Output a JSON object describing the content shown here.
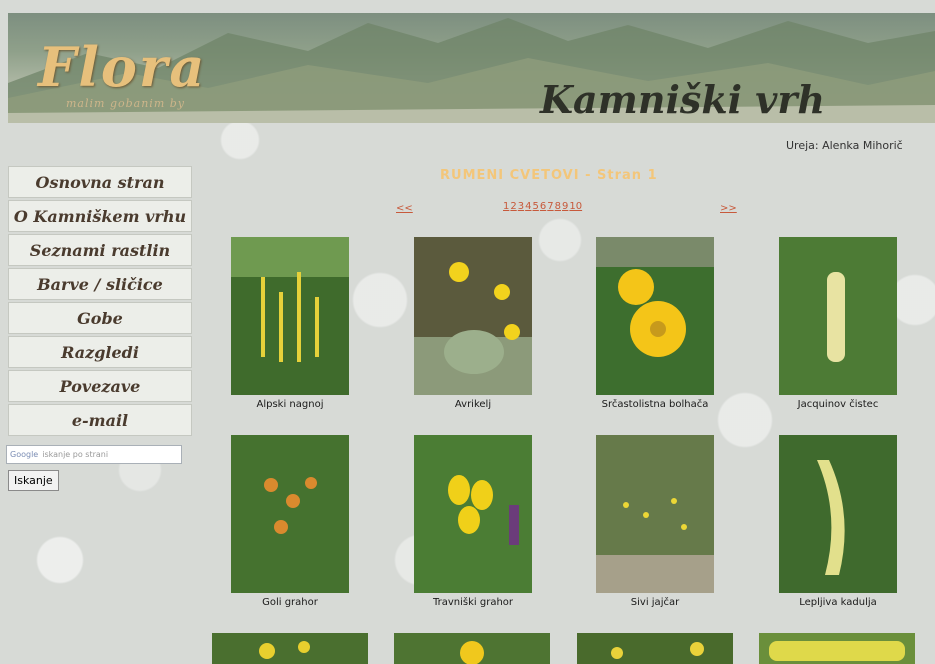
{
  "header": {
    "logo": "Flora",
    "logo_subtitle": "malim gobanim by",
    "site_title": "Kamniški vrh",
    "editor": "Ureja: Alenka Mihorič"
  },
  "nav": {
    "items": [
      {
        "label": "Osnovna stran"
      },
      {
        "label": "O Kamniškem vrhu"
      },
      {
        "label": "Seznami rastlin"
      },
      {
        "label": "Barve / sličice"
      },
      {
        "label": "Gobe"
      },
      {
        "label": "Razgledi"
      },
      {
        "label": "Povezave"
      },
      {
        "label": "e-mail"
      }
    ]
  },
  "search": {
    "brand": "Google",
    "placeholder": "iskanje po strani",
    "button_label": "Iskanje"
  },
  "gallery": {
    "heading": "RUMENI CVETOVI - Stran 1",
    "prev": "<<",
    "next": ">>",
    "pages": [
      "1",
      "2",
      "3",
      "4",
      "5",
      "6",
      "7",
      "8",
      "9",
      "10"
    ],
    "items": [
      {
        "name": "Alpski nagnoj",
        "color": "#e6d13a"
      },
      {
        "name": "Avrikelj",
        "color": "#f2d21d"
      },
      {
        "name": "Srčastolistna bolhača",
        "color": "#f4c518"
      },
      {
        "name": "Jacquinov čistec",
        "color": "#e8e3a2"
      },
      {
        "name": "Goli grahor",
        "color": "#d98a2e"
      },
      {
        "name": "Travniški grahor",
        "color": "#f0d019"
      },
      {
        "name": "Sivi jajčar",
        "color": "#ecd736"
      },
      {
        "name": "Lepljiva kadulja",
        "color": "#e2e08c"
      },
      {
        "name": "",
        "color": "#e8cf2e"
      },
      {
        "name": "",
        "color": "#f0c81d"
      },
      {
        "name": "",
        "color": "#e9d23a"
      },
      {
        "name": "",
        "color": "#dfd94a"
      }
    ]
  }
}
